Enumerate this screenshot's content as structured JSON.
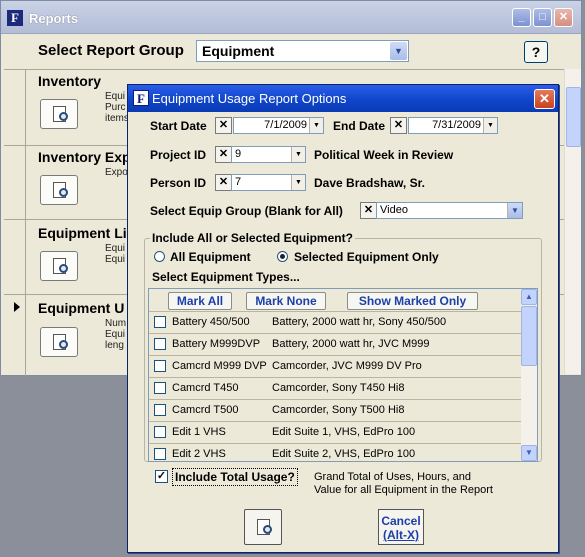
{
  "reports_window": {
    "title": "Reports",
    "report_group_label": "Select Report Group",
    "report_group_value": "Equipment",
    "help_label": "?",
    "reports": [
      {
        "title": "Inventory",
        "desc": "Equi\nPurc\nitems"
      },
      {
        "title": "Inventory Exp",
        "desc": "Expo"
      },
      {
        "title": "Equipment Li",
        "desc": "Equi\nEqui"
      },
      {
        "title": "Equipment U",
        "desc": "Num\nEqui\nleng"
      }
    ]
  },
  "dialog": {
    "title": "Equipment Usage Report Options",
    "close_glyph": "✕",
    "start_date_label": "Start Date",
    "start_date": "7/1/2009",
    "end_date_label": "End Date",
    "end_date": "7/31/2009",
    "project_label": "Project ID",
    "project_id": "9",
    "project_name": "Political Week in Review",
    "person_label": "Person ID",
    "person_id": "7",
    "person_name": "Dave Bradshaw, Sr.",
    "equip_group_label": "Select Equip Group (Blank for All)",
    "equip_group": "Video",
    "clear_glyph": "✕",
    "include_label": "Include All or Selected Equipment?",
    "all_equipment": "All Equipment",
    "selected_only": "Selected Equipment Only",
    "types_label": "Select Equipment Types...",
    "mark_all": "Mark All",
    "mark_none": "Mark None",
    "show_marked": "Show Marked Only",
    "equipment": [
      {
        "code": "Battery 450/500",
        "desc": "Battery, 2000 watt hr, Sony 450/500"
      },
      {
        "code": "Battery M999DVP",
        "desc": "Battery, 2000 watt hr, JVC M999"
      },
      {
        "code": "Camcrd M999 DVP",
        "desc": "Camcorder, JVC M999 DV Pro"
      },
      {
        "code": "Camcrd T450",
        "desc": "Camcorder, Sony T450 Hi8"
      },
      {
        "code": "Camcrd T500",
        "desc": "Camcorder, Sony T500 Hi8"
      },
      {
        "code": "Edit 1 VHS",
        "desc": "Edit Suite 1, VHS, EdPro 100"
      },
      {
        "code": "Edit 2 VHS",
        "desc": "Edit Suite 2, VHS, EdPro 100"
      }
    ],
    "include_total_label": "Include Total Usage?",
    "include_total_checked": true,
    "check_glyph": "✓",
    "include_total_note": "Grand Total of Uses, Hours, and\nValue for all Equipment in the Report",
    "cancel_label": "Cancel",
    "cancel_shortcut": "(Alt-X)"
  }
}
